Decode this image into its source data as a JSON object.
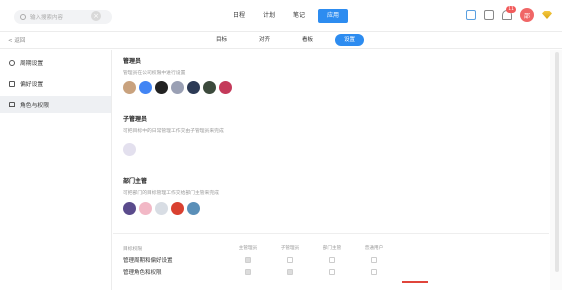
{
  "topbar": {
    "search_placeholder": "输入搜索内容",
    "clear_label": "×",
    "tabs": [
      {
        "label": "日程",
        "active": false
      },
      {
        "label": "计划",
        "active": false
      },
      {
        "label": "笔记",
        "active": false
      },
      {
        "label": "应用",
        "active": true
      }
    ],
    "notify_count": "11",
    "avatar_text": "邵"
  },
  "subbar": {
    "back_label": "< 返回",
    "tabs": [
      {
        "label": "目标",
        "active": false
      },
      {
        "label": "对齐",
        "active": false
      },
      {
        "label": "看板",
        "active": false
      },
      {
        "label": "设置",
        "active": true
      }
    ]
  },
  "sidebar": {
    "items": [
      {
        "label": "周期设置",
        "icon": "clock-icon",
        "active": false
      },
      {
        "label": "偏好设置",
        "icon": "command-icon",
        "active": false
      },
      {
        "label": "角色与权限",
        "icon": "lock-icon",
        "active": true
      }
    ]
  },
  "sections": [
    {
      "title": "管理员",
      "desc": "管理员在公司权限中进行设置",
      "avatars": [
        "#c9a27e",
        "#4285f4",
        "#222222",
        "#9aa0b4",
        "#2c3a55",
        "#3c4a3c",
        "#c43a5a"
      ]
    },
    {
      "title": "子管理员",
      "desc": "可把目标中的日常管理工作交由子管理员来完成",
      "avatars": [
        "#e3e0ee"
      ]
    },
    {
      "title": "部门主管",
      "desc": "可把部门的目标管理工作交给部门主管来完成",
      "avatars": [
        "#5a4b8c",
        "#f2b8c6",
        "#d8dde4",
        "#d94030",
        "#5a8fb8"
      ]
    }
  ],
  "permissions": {
    "headers": [
      "目标权限",
      "主管理员",
      "子管理员",
      "部门主管",
      "普通用户"
    ],
    "rows": [
      {
        "name": "管理周期和偏好设置",
        "values": [
          true,
          false,
          false,
          false
        ]
      },
      {
        "name": "管理角色和权限",
        "values": [
          true,
          true,
          false,
          false
        ]
      }
    ]
  },
  "colors": {
    "accent": "#2d8cf0",
    "avatar_red": "#f06666"
  }
}
